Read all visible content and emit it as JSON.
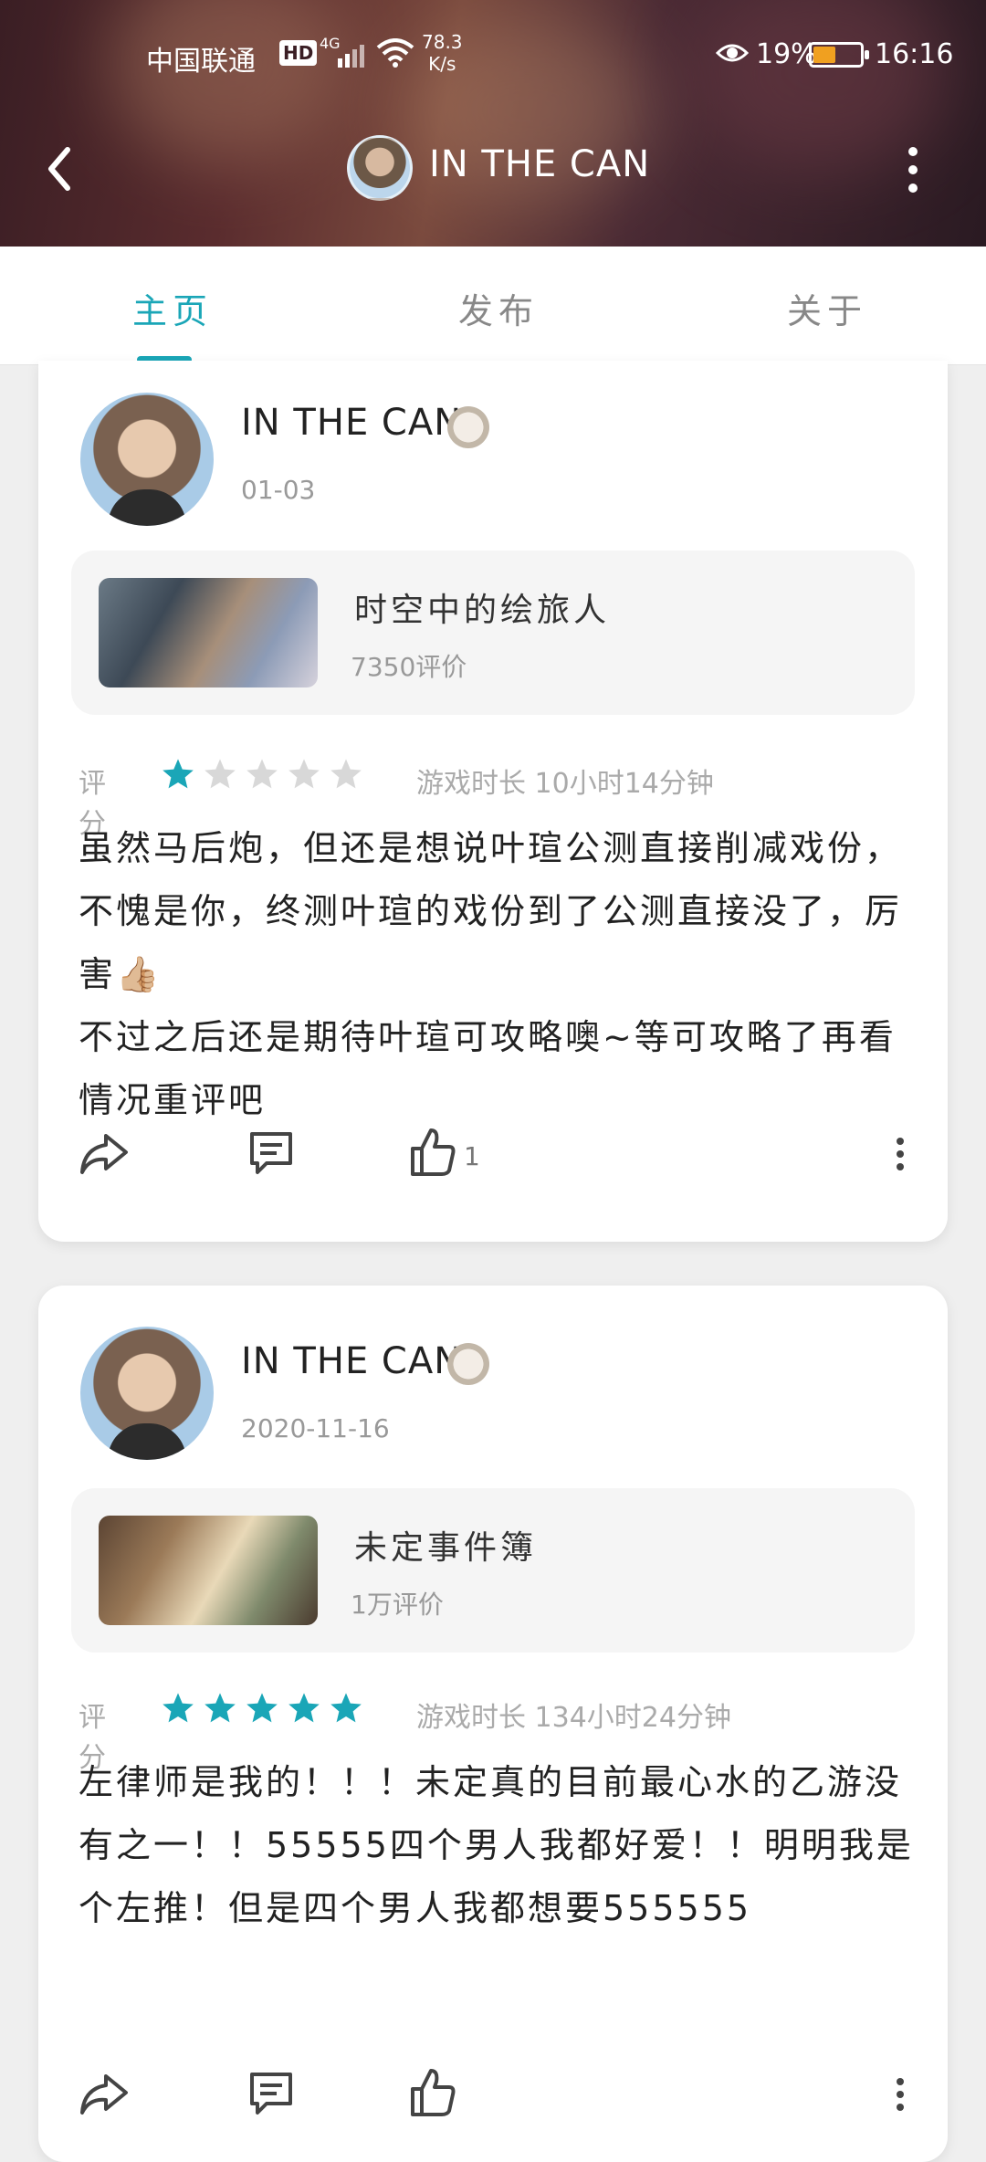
{
  "status_bar": {
    "carrier": "中国联通",
    "hd": "HD",
    "network": "4G",
    "speed_value": "78.3",
    "speed_unit": "K/s",
    "battery": "19%",
    "time": "16:16"
  },
  "nav": {
    "title": "IN THE CAN"
  },
  "tabs": [
    {
      "label": "主页",
      "active": true
    },
    {
      "label": "发布",
      "active": false
    },
    {
      "label": "关于",
      "active": false
    }
  ],
  "colors": {
    "accent": "#1aa6b7",
    "star_off": "#d8d8d8"
  },
  "posts": [
    {
      "author": "IN THE CAN",
      "date": "01-03",
      "game": {
        "name": "时空中的绘旅人",
        "reviews": "7350评价"
      },
      "rating_label": "评分",
      "stars": 1,
      "playtime": "游戏时长 10小时14分钟",
      "text": "虽然马后炮，但还是想说叶瑄公测直接削减戏份，不愧是你，终测叶瑄的戏份到了公测直接没了，厉害👍🏼\n不过之后还是期待叶瑄可攻略噢~等可攻略了再看情况重评吧",
      "likes": "1"
    },
    {
      "author": "IN THE CAN",
      "date": "2020-11-16",
      "game": {
        "name": "未定事件簿",
        "reviews": "1万评价"
      },
      "rating_label": "评分",
      "stars": 5,
      "playtime": "游戏时长 134小时24分钟",
      "text": "左律师是我的！！！未定真的目前最心水的乙游没有之一！！55555四个男人我都好爱！！明明我是个左推！但是四个男人我都想要555555",
      "likes": ""
    }
  ]
}
